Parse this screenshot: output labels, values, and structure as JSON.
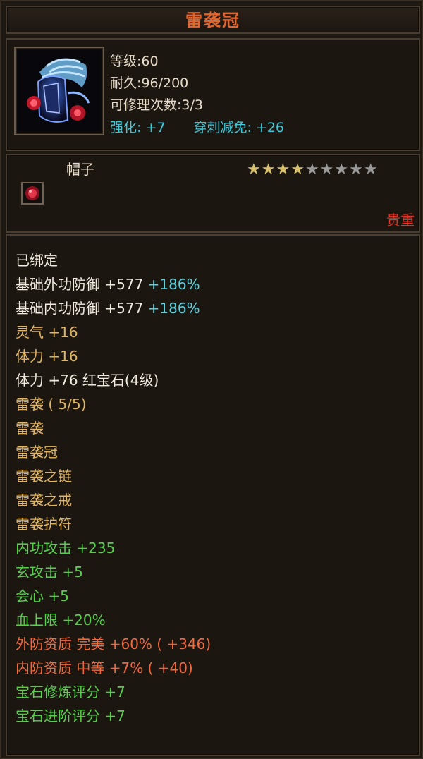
{
  "header": {
    "title": "雷袭冠"
  },
  "item": {
    "stats": {
      "level": "等级:60",
      "durability": "耐久:96/200",
      "repairs": "可修理次数:3/3",
      "enhance": "强化: +7",
      "pierce_reduce": "穿刺减免: +26"
    },
    "name": "帽子",
    "stars": {
      "filled": 4,
      "total": 9
    },
    "rarity": "贵重",
    "gem_icon": "red-gem-icon"
  },
  "attributes": [
    {
      "text": "已绑定",
      "color": "white"
    },
    {
      "text": "基础外功防御 +577",
      "extra": " +186%",
      "color": "white",
      "extra_color": "cyan"
    },
    {
      "text": "基础内功防御 +577",
      "extra": " +186%",
      "color": "white",
      "extra_color": "cyan"
    },
    {
      "text": "灵气 +16",
      "color": "gold"
    },
    {
      "text": "体力 +16",
      "color": "gold"
    },
    {
      "text": "体力 +76 红宝石(4级)",
      "color": "white"
    },
    {
      "text": "雷袭 ( 5/5)",
      "color": "gold"
    },
    {
      "text": "雷袭",
      "color": "gold"
    },
    {
      "text": "雷袭冠",
      "color": "gold"
    },
    {
      "text": "雷袭之链",
      "color": "gold"
    },
    {
      "text": "雷袭之戒",
      "color": "gold"
    },
    {
      "text": "雷袭护符",
      "color": "gold"
    },
    {
      "text": "内功攻击 +235",
      "color": "green"
    },
    {
      "text": "玄攻击 +5",
      "color": "green"
    },
    {
      "text": "会心 +5",
      "color": "green"
    },
    {
      "text": "血上限 +20%",
      "color": "green"
    },
    {
      "text": "外防资质  完美 +60% ( +346)",
      "color": "orange"
    },
    {
      "text": "内防资质  中等 +7% ( +40)",
      "color": "orange"
    },
    {
      "text": "宝石修炼评分 +7",
      "color": "green"
    },
    {
      "text": "宝石进阶评分 +7",
      "color": "green"
    }
  ]
}
